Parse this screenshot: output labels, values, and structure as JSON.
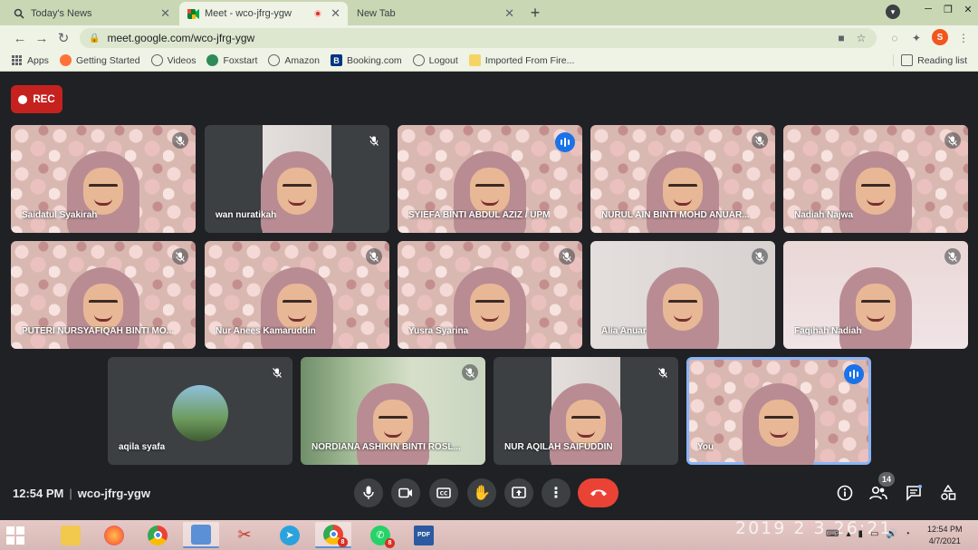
{
  "browser": {
    "tabs": [
      {
        "title": "Today's News",
        "icon": "search-icon"
      },
      {
        "title": "Meet - wco-jfrg-ygw",
        "icon": "meet-icon",
        "recording": true
      },
      {
        "title": "New Tab",
        "icon": ""
      }
    ],
    "url": "meet.google.com/wco-jfrg-ygw",
    "bookmarks": [
      {
        "label": "Apps",
        "icon": "apps-grid-icon"
      },
      {
        "label": "Getting Started",
        "icon": "firefox-icon"
      },
      {
        "label": "Videos",
        "icon": "globe-icon"
      },
      {
        "label": "Foxstart",
        "icon": "foxstart-icon"
      },
      {
        "label": "Amazon",
        "icon": "globe-icon"
      },
      {
        "label": "Booking.com",
        "icon": "booking-icon"
      },
      {
        "label": "Logout",
        "icon": "globe-icon"
      },
      {
        "label": "Imported From Fire...",
        "icon": "folder-icon"
      }
    ],
    "reading_list": "Reading list",
    "profile_initial": "S"
  },
  "meet": {
    "rec_label": "REC",
    "participants": [
      {
        "name": "Saidatul Syakirah",
        "status": "muted",
        "bg": "floral"
      },
      {
        "name": "wan nuratikah",
        "status": "muted",
        "bg": "portrait"
      },
      {
        "name": "SYIEFA BINTI ABDUL AZIZ / UPM",
        "status": "speaking",
        "bg": "floral"
      },
      {
        "name": "NURUL AIN BINTI MOHD ANUAR...",
        "status": "muted",
        "bg": "floral"
      },
      {
        "name": "Nadiah Najwa",
        "status": "muted",
        "bg": "floral"
      },
      {
        "name": "PUTERI NURSYAFIQAH BINTI MO...",
        "status": "muted",
        "bg": "floral"
      },
      {
        "name": "Nur Anees Kamaruddin",
        "status": "muted",
        "bg": "floral"
      },
      {
        "name": "Yusra Syarina",
        "status": "muted",
        "bg": "floral"
      },
      {
        "name": "Alia Anuar",
        "status": "muted",
        "bg": "room-white"
      },
      {
        "name": "Faqihah Nadiah",
        "status": "muted",
        "bg": "room-pale"
      },
      {
        "name": "aqila syafa",
        "status": "muted",
        "bg": "avatar"
      },
      {
        "name": "NORDIANA ASHIKIN BINTI ROSL...",
        "status": "muted",
        "bg": "room-green"
      },
      {
        "name": "NUR AQILAH SAIFUDDIN",
        "status": "muted",
        "bg": "portrait"
      },
      {
        "name": "You",
        "status": "speaking",
        "bg": "floral"
      }
    ],
    "time": "12:54 PM",
    "meeting_code": "wco-jfrg-ygw",
    "people_count": "14"
  },
  "taskbar": {
    "wallpaper_text": "2019 2 3 26:21",
    "chrome_badge": "8",
    "whatsapp_badge": "8",
    "clock_time": "12:54 PM",
    "clock_date": "4/7/2021"
  },
  "colors": {
    "meet_bg": "#202124",
    "tile_bg": "#3c4043",
    "speaking_blue": "#1a73e8",
    "end_call_red": "#ea4335",
    "rec_red": "#c5221f"
  }
}
